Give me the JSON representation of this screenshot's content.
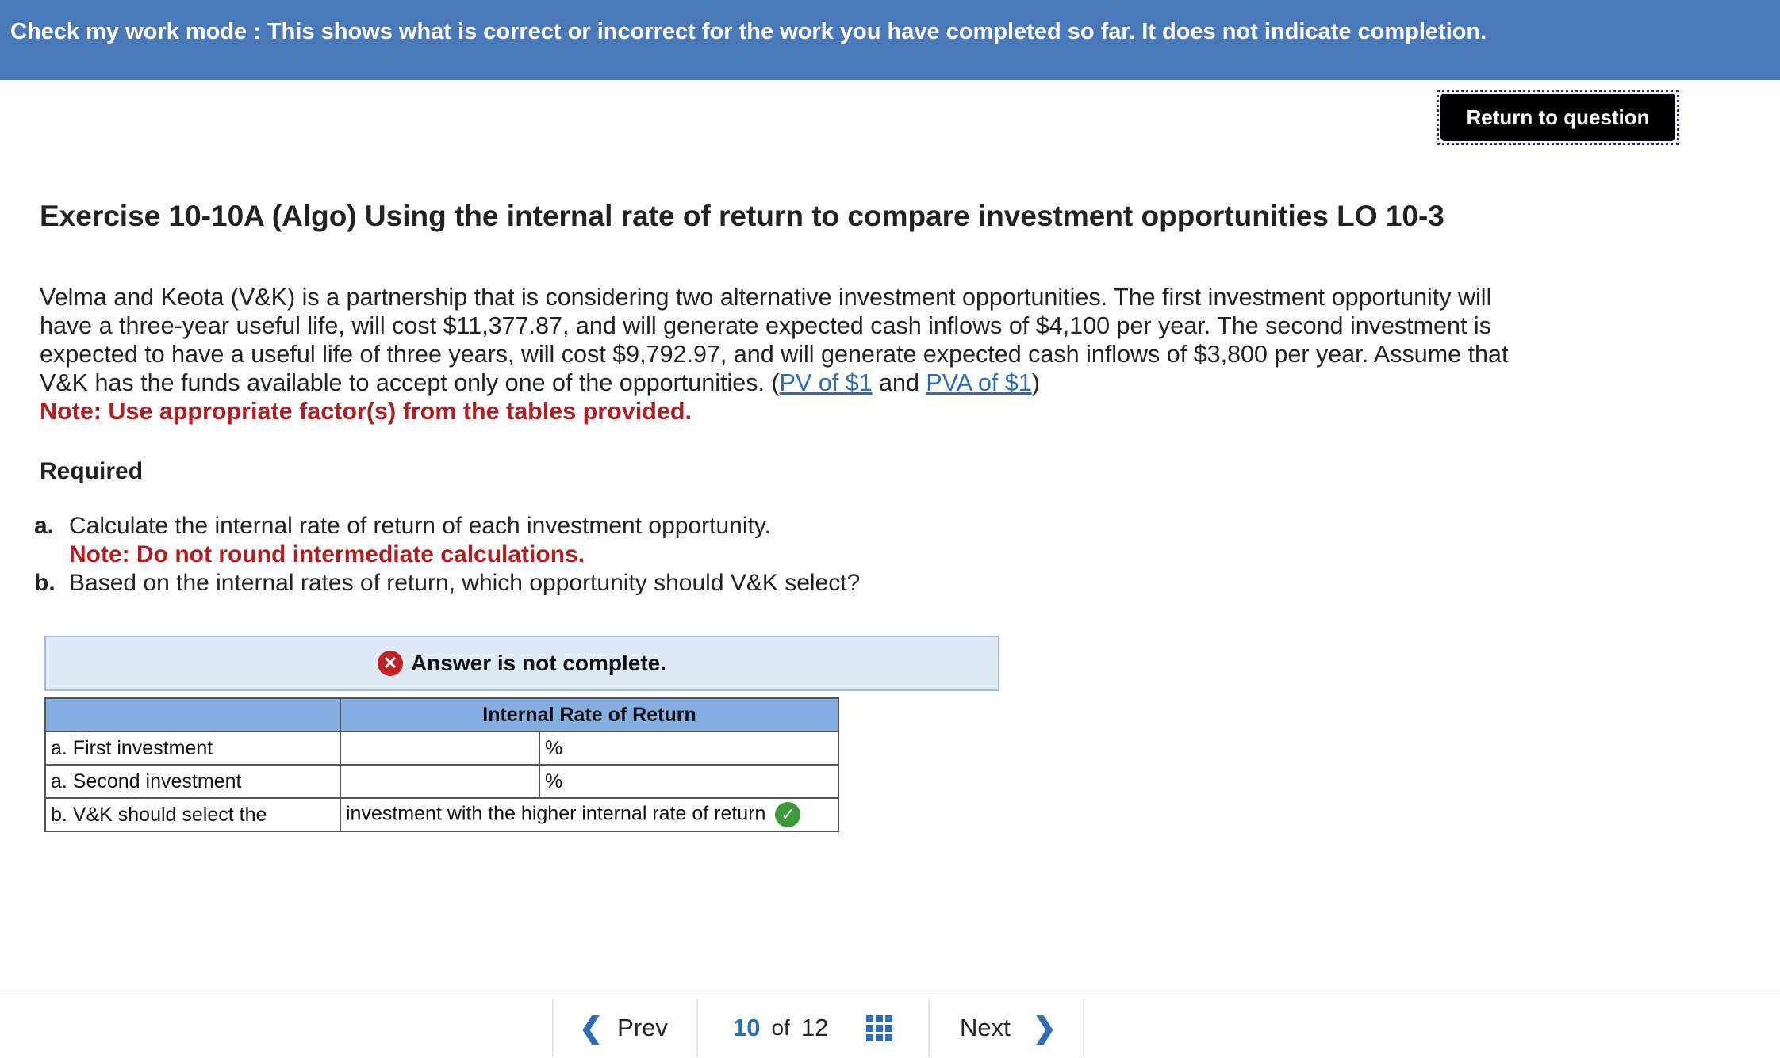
{
  "banner": {
    "text": "Check my work mode : This shows what is correct or incorrect for the work you have completed so far. It does not indicate completion."
  },
  "return_button": "Return to question",
  "exercise": {
    "title": "Exercise 10-10A (Algo) Using the internal rate of return to compare investment opportunities LO 10-3",
    "intro_1": "Velma and Keota (V&K) is a partnership that is considering two alternative investment opportunities. The first investment opportunity will have a three-year useful life, will cost $11,377.87, and will generate expected cash inflows of $4,100 per year. The second investment is expected to have a useful life of three years, will cost $9,792.97, and will generate expected cash inflows of $3,800 per year. Assume that V&K has the funds available to accept only one of the opportunities. (",
    "link_pv": "PV of $1",
    "and_text": " and ",
    "link_pva": "PVA of $1",
    "close_paren": ")",
    "note": "Note: Use appropriate factor(s) from the tables provided."
  },
  "required": {
    "heading": "Required",
    "items": [
      {
        "letter": "a.",
        "text": "Calculate the internal rate of return of each investment opportunity.",
        "note": "Note: Do not round intermediate calculations."
      },
      {
        "letter": "b.",
        "text": "Based on the internal rates of return, which opportunity should V&K select?"
      }
    ]
  },
  "answer_status": "Answer is not complete.",
  "answer_table": {
    "header": "Internal Rate of Return",
    "rows": [
      {
        "label": "a. First investment",
        "value": "",
        "unit": "%"
      },
      {
        "label": "a. Second investment",
        "value": "",
        "unit": "%"
      },
      {
        "label": "b. V&K should select the",
        "answer": "investment with the higher internal rate of return"
      }
    ]
  },
  "navigation": {
    "prev": "Prev",
    "current": "10",
    "of": "of",
    "total": "12",
    "next": "Next"
  },
  "colors": {
    "banner": "#4a79b9",
    "link": "#2d6db5",
    "note_red": "#b01e23",
    "table_header": "#86aee2",
    "correct": "#3c9a3c",
    "incorrect": "#c21f26"
  }
}
